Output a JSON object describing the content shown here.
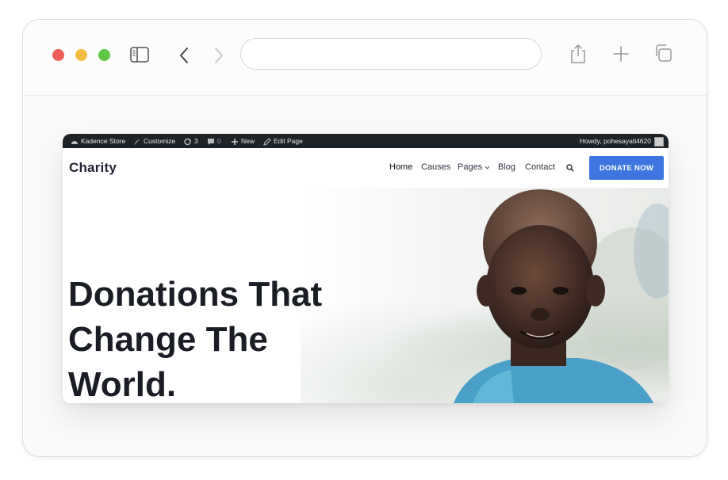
{
  "browser": {
    "address_value": "",
    "icons": [
      "sidebar-icon",
      "back-icon",
      "forward-icon",
      "share-icon",
      "new-tab-icon",
      "tabs-overview-icon"
    ]
  },
  "wp_admin_bar": {
    "site_name": "Kadence Store",
    "customize": "Customize",
    "updates_count": "3",
    "comments_count": "0",
    "new": "New",
    "edit_page": "Edit Page",
    "howdy": "Howdy, pohesayati4620"
  },
  "site": {
    "logo": "Charity",
    "nav": {
      "home": "Home",
      "causes": "Causes",
      "pages": "Pages",
      "blog": "Blog",
      "contact": "Contact"
    },
    "donate_label": "DONATE NOW",
    "colors": {
      "accent": "#3f75e0",
      "admin_bar": "#1d2327",
      "heading": "#1a1d24"
    }
  },
  "hero": {
    "title_lines": [
      "Donations That",
      "Change The",
      "World."
    ]
  }
}
